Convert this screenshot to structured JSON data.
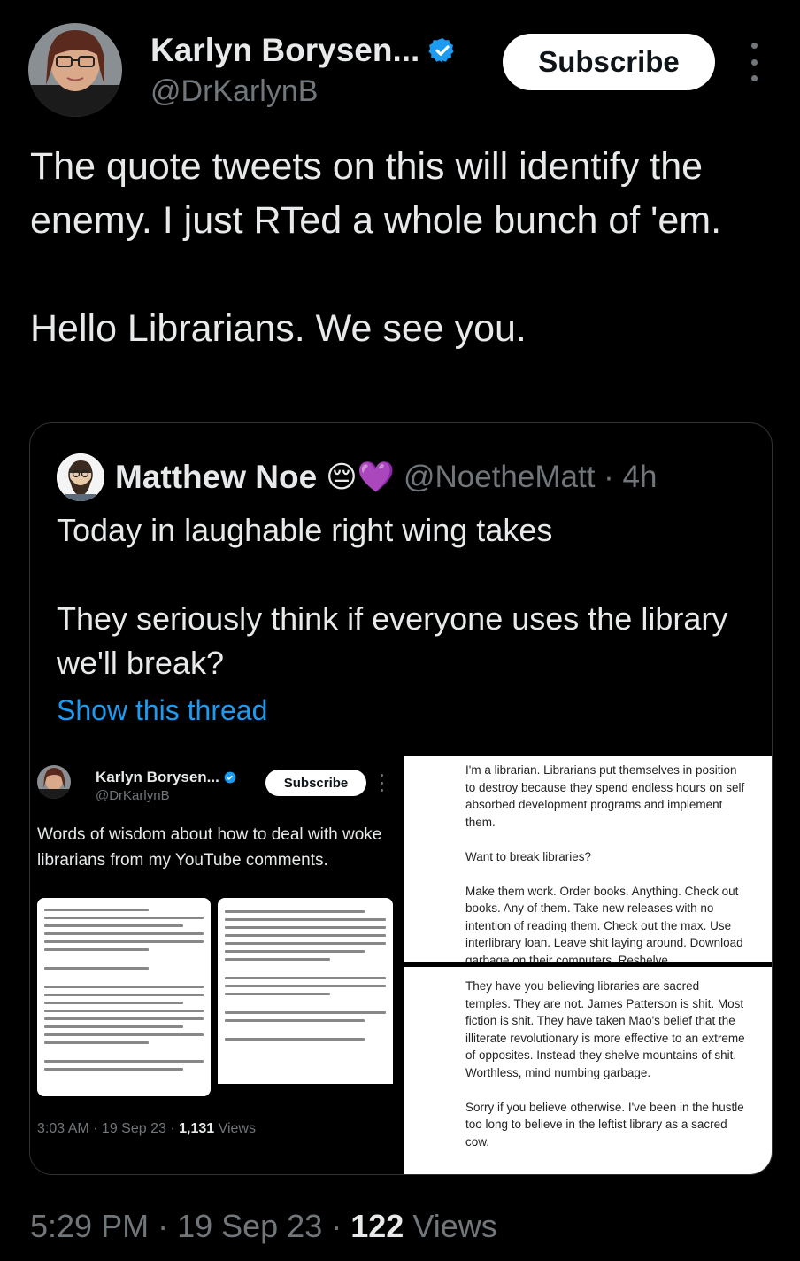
{
  "author": {
    "name": "Karlyn Borysen...",
    "handle": "@DrKarlynB",
    "subscribe_label": "Subscribe"
  },
  "tweet": {
    "paragraphs": [
      "The quote tweets on this will identify the enemy. I just RTed a whole bunch of 'em.",
      "Hello Librarians. We see you."
    ],
    "time": "5:29 PM",
    "date": "19 Sep 23",
    "views_count": "122",
    "views_label": "Views"
  },
  "quoted": {
    "name": "Matthew Noe",
    "emoji": "😔💜",
    "handle": "@NoetheMatt",
    "age": "4h",
    "paragraphs": [
      "Today in laughable right wing takes",
      "They seriously think if everyone uses the library we'll break?"
    ],
    "show_thread": "Show this thread"
  },
  "media_screenshot": {
    "name": "Karlyn Borysen...",
    "handle": "@DrKarlynB",
    "subscribe_label": "Subscribe",
    "text": "Words of wisdom about how to deal with woke librarians from my YouTube comments.",
    "time": "3:03 AM",
    "date": "19 Sep 23",
    "views_count": "1,131",
    "views_label": "Views"
  },
  "media_doc_top": {
    "p1": "I'm a librarian. Librarians put themselves in position to destroy because they spend endless hours on self absorbed development programs and implement them.",
    "p2": "Want to break libraries?",
    "p3": "Make them work. Order books. Anything. Check out books. Any of them. Take new releases with no intention of reading them. Check out the max. Use interlibrary loan.  Leave shit laying around. Download garbage on their computers. Reshelve"
  },
  "media_doc_bottom": {
    "p1": "They have you believing libraries are sacred temples. They are not. James Patterson is shit. Most fiction is shit. They have taken Mao's belief that the illiterate revolutionary is more effective to an extreme of opposites. Instead they shelve mountains of shit. Worthless, mind numbing garbage.",
    "p2": "Sorry if you believe otherwise. I've been in the hustle too long to believe in the leftist library as a sacred cow."
  },
  "colors": {
    "background": "#000000",
    "text": "#e7e9ea",
    "muted": "#71767b",
    "link": "#1d9bf0",
    "verified": "#1d9bf0"
  }
}
